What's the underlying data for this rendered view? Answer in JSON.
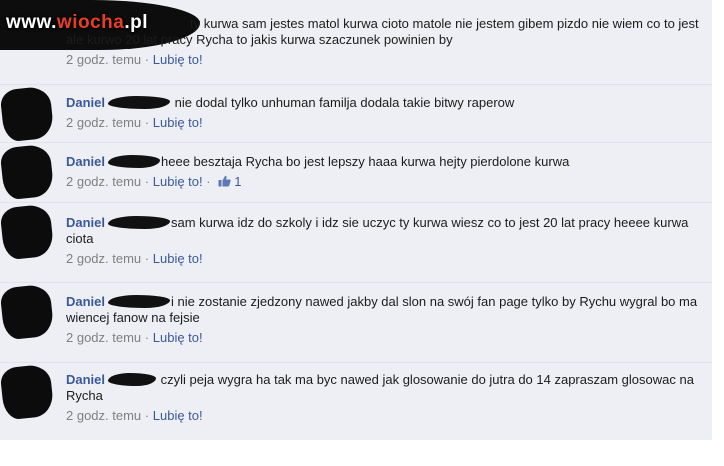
{
  "watermark": {
    "prefix": "www.",
    "accent": "wiocha",
    "suffix": ".pl"
  },
  "comments": [
    {
      "author": "",
      "text": "ty kurwa sam jestes matol kurwa cioto matole nie jestem gibem pizdo nie wiem co to jest ale kurwo 20 lat pracy Rycha to jakis kurwa szaczunek powinien by",
      "time": "2 godz. temu",
      "separator": "·",
      "like_label": "Lubię to!"
    },
    {
      "author": "Daniel",
      "text": "nie dodal tylko unhuman familja dodala takie bitwy raperow",
      "time": "2 godz. temu",
      "separator": "·",
      "like_label": "Lubię to!"
    },
    {
      "author": "Daniel",
      "text": "heee besztaja Rycha bo jest lepszy haaa kurwa hejty pierdolone kurwa",
      "time": "2 godz. temu",
      "separator": "·",
      "like_label": "Lubię to!",
      "likes_separator": "·",
      "likes": "1"
    },
    {
      "author": "Daniel",
      "text": "sam kurwa idz do szkoly i idz sie uczyc ty kurwa wiesz co to jest 20 lat pracy heeee kurwa ciota",
      "time": "2 godz. temu",
      "separator": "·",
      "like_label": "Lubię to!"
    },
    {
      "author": "Daniel",
      "text": "i nie zostanie zjedzony nawed jakby dal slon na swój fan page tylko by Rychu wygral bo ma wiencej fanow na fejsie",
      "time": "2 godz. temu",
      "separator": "·",
      "like_label": "Lubię to!"
    },
    {
      "author": "Daniel",
      "text": "czyli peja wygra ha tak ma byc nawed jak glosowanie do jutra do 14 zapraszam glosowac na Rycha",
      "time": "2 godz. temu",
      "separator": "·",
      "like_label": "Lubię to!"
    }
  ],
  "colors": {
    "link": "#3b5998",
    "background": "#edeff4",
    "meta": "#808080",
    "watermark_accent": "#e83e28"
  },
  "icons": {
    "like": "thumbs-up-icon"
  }
}
